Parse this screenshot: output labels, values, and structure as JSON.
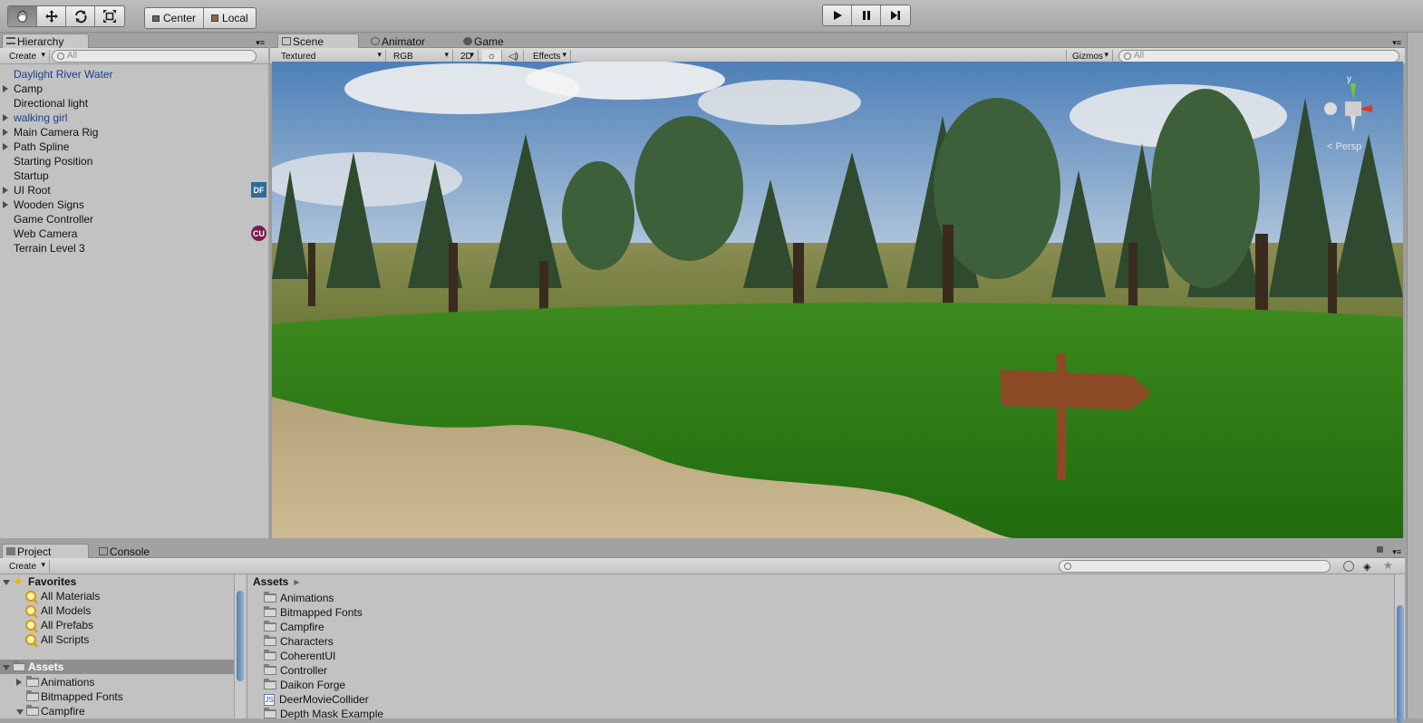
{
  "toolbar": {
    "tools": [
      "hand-tool",
      "move-tool",
      "rotate-tool",
      "scale-tool"
    ],
    "pivot_label": "Center",
    "space_label": "Local"
  },
  "hierarchy": {
    "tab_label": "Hierarchy",
    "create_label": "Create",
    "search_placeholder": "All",
    "items": [
      {
        "label": "Daylight River Water",
        "prefab": true,
        "expand": false
      },
      {
        "label": "Camp",
        "prefab": false,
        "expand": true
      },
      {
        "label": "Directional light",
        "prefab": false,
        "expand": false
      },
      {
        "label": "walking girl",
        "prefab": true,
        "expand": true
      },
      {
        "label": "Main Camera Rig",
        "prefab": false,
        "expand": true
      },
      {
        "label": "Path Spline",
        "prefab": false,
        "expand": true
      },
      {
        "label": "Starting Position",
        "prefab": false,
        "expand": false
      },
      {
        "label": "Startup",
        "prefab": false,
        "expand": false
      },
      {
        "label": "UI Root",
        "prefab": false,
        "expand": true,
        "badge": "DF"
      },
      {
        "label": "Wooden Signs",
        "prefab": false,
        "expand": true
      },
      {
        "label": "Game Controller",
        "prefab": false,
        "expand": false
      },
      {
        "label": "Web Camera",
        "prefab": false,
        "expand": false,
        "badge": "CU"
      },
      {
        "label": "Terrain Level 3",
        "prefab": false,
        "expand": false
      }
    ]
  },
  "scene": {
    "tabs": [
      "Scene",
      "Animator",
      "Game"
    ],
    "render_mode": "Textured",
    "color_mode": "RGB",
    "mode_2d": "2D",
    "effects_label": "Effects",
    "gizmos_label": "Gizmos",
    "search_placeholder": "All",
    "gizmo_axis_y": "y",
    "projection_label": "< Persp"
  },
  "project": {
    "tabs": [
      "Project",
      "Console"
    ],
    "create_label": "Create",
    "favorites_label": "Favorites",
    "favorites": [
      "All Materials",
      "All Models",
      "All Prefabs",
      "All Scripts"
    ],
    "assets_label": "Assets",
    "tree": [
      {
        "label": "Animations",
        "expand": "right"
      },
      {
        "label": "Bitmapped Fonts",
        "expand": "none"
      },
      {
        "label": "Campfire",
        "expand": "down"
      }
    ],
    "breadcrumb": "Assets",
    "files": [
      {
        "label": "Animations",
        "type": "folder"
      },
      {
        "label": "Bitmapped Fonts",
        "type": "folder"
      },
      {
        "label": "Campfire",
        "type": "folder"
      },
      {
        "label": "Characters",
        "type": "folder"
      },
      {
        "label": "CoherentUI",
        "type": "folder"
      },
      {
        "label": "Controller",
        "type": "folder"
      },
      {
        "label": "Daikon Forge",
        "type": "folder"
      },
      {
        "label": "DeerMovieCollider",
        "type": "script"
      },
      {
        "label": "Depth Mask Example",
        "type": "folder"
      }
    ]
  },
  "colors": {
    "selection": "#8f8f8f",
    "prefab_text": "#1b3e93",
    "panel_bg": "#c2c2c2"
  }
}
